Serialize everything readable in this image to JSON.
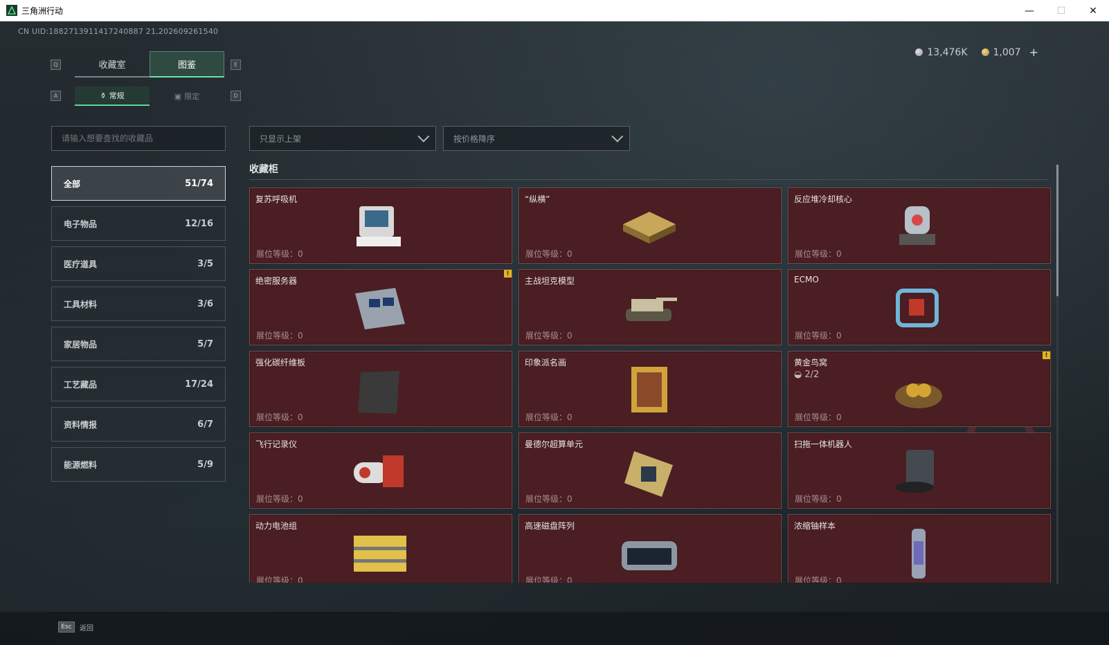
{
  "window": {
    "title": "三角洲行动",
    "minimize": "—",
    "maximize": "☐",
    "close": "✕"
  },
  "uid": "CN UID:1882713911417240887 21,202609261540",
  "currency": {
    "silver": "13,476K",
    "gold": "1,007",
    "add": "+"
  },
  "keys": {
    "q": "Q",
    "e": "E",
    "a": "A",
    "d": "D",
    "esc": "Esc"
  },
  "tabs": {
    "collection_room": "收藏室",
    "catalog": "图鉴"
  },
  "subtabs": {
    "regular": "常规",
    "limited": "限定"
  },
  "search": {
    "placeholder": "请输入想要查找的收藏品"
  },
  "filters": {
    "shelf": "只显示上架",
    "sort": "按价格降序"
  },
  "categories": [
    {
      "label": "全部",
      "count": "51/74"
    },
    {
      "label": "电子物品",
      "count": "12/16"
    },
    {
      "label": "医疗道具",
      "count": "3/5"
    },
    {
      "label": "工具材料",
      "count": "3/6"
    },
    {
      "label": "家居物品",
      "count": "5/7"
    },
    {
      "label": "工艺藏品",
      "count": "17/24"
    },
    {
      "label": "资料情报",
      "count": "6/7"
    },
    {
      "label": "能源燃料",
      "count": "5/9"
    }
  ],
  "section_title": "收藏柜",
  "items": [
    {
      "name": "复苏呼吸机",
      "level": "展位等级：0",
      "icon": "ventilator-icon",
      "color": "#d8d8d8"
    },
    {
      "name": "“纵横”",
      "level": "展位等级：0",
      "icon": "chessboard-icon",
      "color": "#c9a75a"
    },
    {
      "name": "反应堆冷却核心",
      "level": "展位等级：0",
      "icon": "reactor-core-icon",
      "color": "#b8c0c8"
    },
    {
      "name": "绝密服务器",
      "level": "展位等级：0",
      "icon": "server-icon",
      "color": "#9aa3ad",
      "badge": "!"
    },
    {
      "name": "主战坦克模型",
      "level": "展位等级：0",
      "icon": "tank-icon",
      "color": "#c8c0a0"
    },
    {
      "name": "ECMO",
      "level": "展位等级：0",
      "icon": "ecmo-icon",
      "color": "#6fb6d8"
    },
    {
      "name": "强化碳纤维板",
      "level": "展位等级：0",
      "icon": "carbon-plate-icon",
      "color": "#3a3a3a"
    },
    {
      "name": "印象派名画",
      "level": "展位等级：0",
      "icon": "painting-icon",
      "color": "#d1a33c"
    },
    {
      "name": "黄金鸟窝",
      "level": "展位等级：0",
      "icon": "golden-nest-icon",
      "color": "#d4a531",
      "count": "2/2",
      "badge": "!"
    },
    {
      "name": "飞行记录仪",
      "level": "展位等级：0",
      "icon": "flight-recorder-icon",
      "color": "#c0392b"
    },
    {
      "name": "曼德尔超算单元",
      "level": "展位等级：0",
      "icon": "supercomputer-unit-icon",
      "color": "#c9b06a"
    },
    {
      "name": "扫拖一体机器人",
      "level": "展位等级：0",
      "icon": "robot-vacuum-icon",
      "color": "#444a50"
    },
    {
      "name": "动力电池组",
      "level": "展位等级：0",
      "icon": "battery-pack-icon",
      "color": "#e2c14a"
    },
    {
      "name": "高速磁盘阵列",
      "level": "展位等级：0",
      "icon": "disk-array-icon",
      "color": "#8d97a3"
    },
    {
      "name": "浓缩铀样本",
      "level": "展位等级：0",
      "icon": "uranium-sample-icon",
      "color": "#9aa2b8"
    }
  ],
  "back_label": "返回",
  "colors": {
    "accent": "#6fe0b0",
    "card_bg": "#4a1e22",
    "card_border": "#7a4a4e"
  }
}
